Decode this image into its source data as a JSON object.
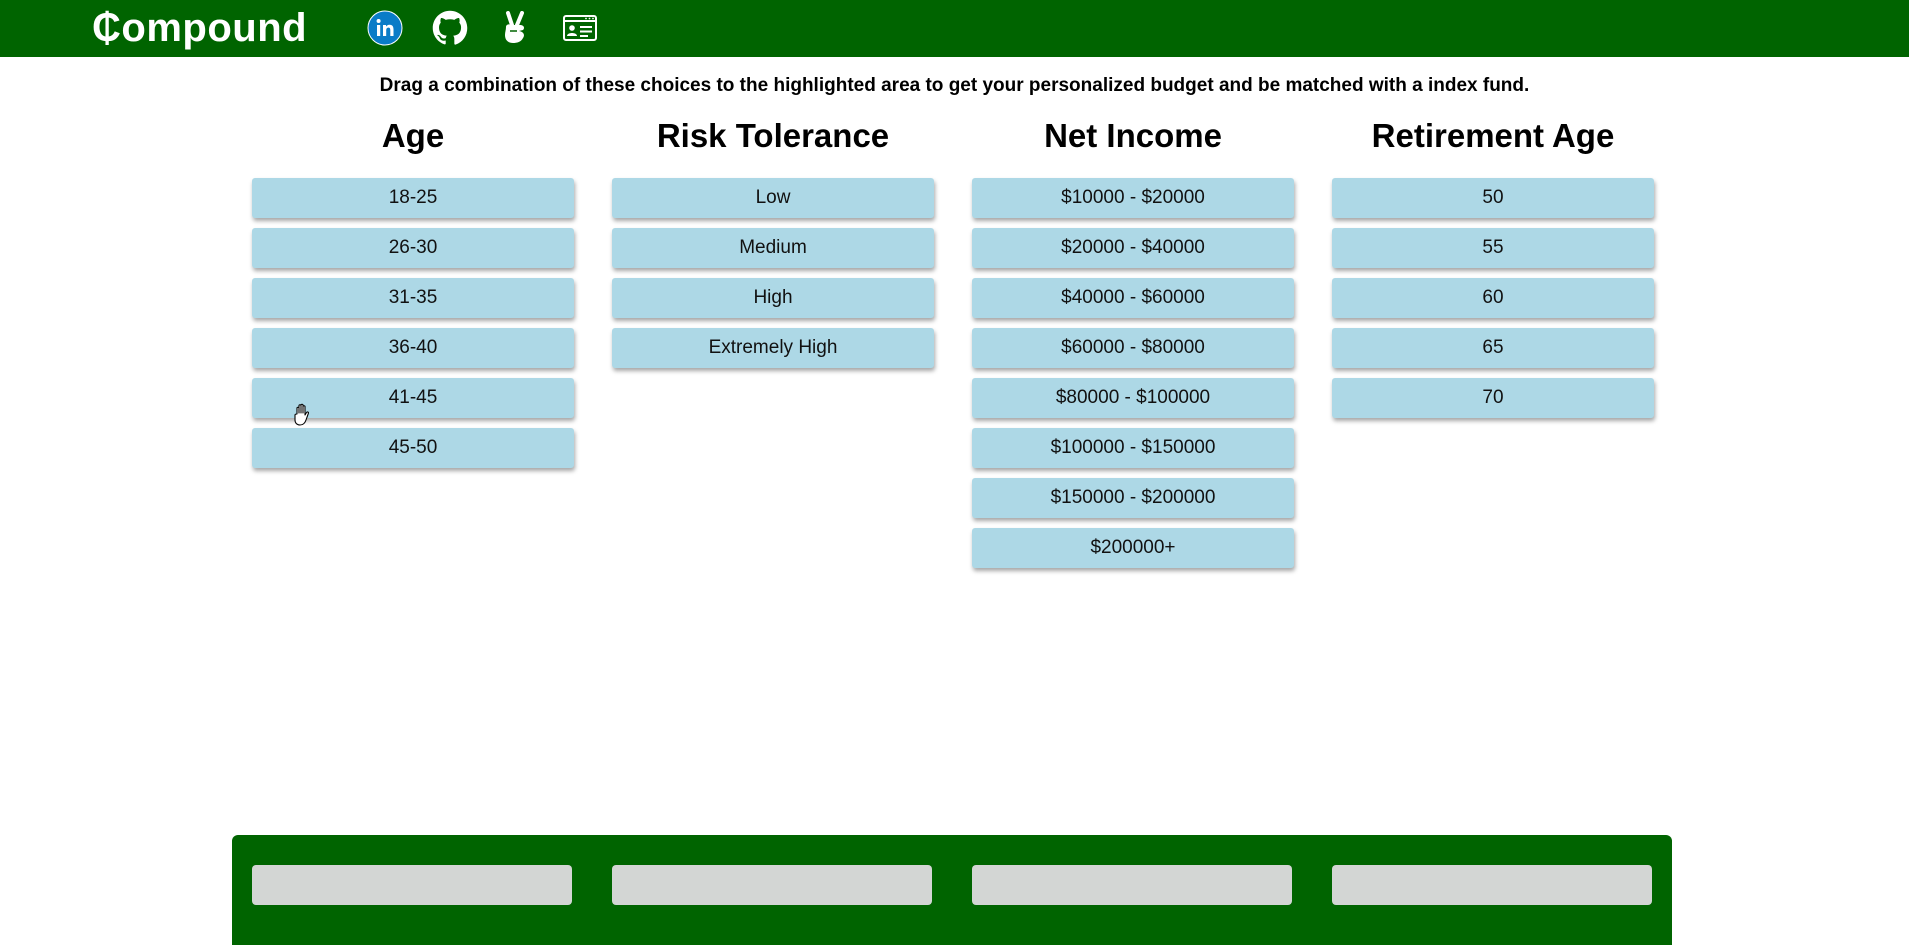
{
  "nav": {
    "brand": "₵ompound",
    "icons": [
      "linkedin-icon",
      "github-icon",
      "angellist-icon",
      "portfolio-icon"
    ],
    "color": "#006400"
  },
  "instructions": "Drag a combination of these choices to the highlighted area to get your personalized budget and be matched with a index fund.",
  "columns": [
    {
      "title": "Age",
      "options": [
        "18-25",
        "26-30",
        "31-35",
        "36-40",
        "41-45",
        "45-50"
      ]
    },
    {
      "title": "Risk Tolerance",
      "options": [
        "Low",
        "Medium",
        "High",
        "Extremely High"
      ]
    },
    {
      "title": "Net Income",
      "options": [
        "$10000 - $20000",
        "$20000 - $40000",
        "$40000 - $60000",
        "$60000 - $80000",
        "$80000 - $100000",
        "$100000 - $150000",
        "$150000 - $200000",
        "$200000+"
      ]
    },
    {
      "title": "Retirement Age",
      "options": [
        "50",
        "55",
        "60",
        "65",
        "70"
      ]
    }
  ],
  "colors": {
    "choice": "#add8e6",
    "dropzone": "#006400",
    "slot": "#d3d6d4"
  }
}
